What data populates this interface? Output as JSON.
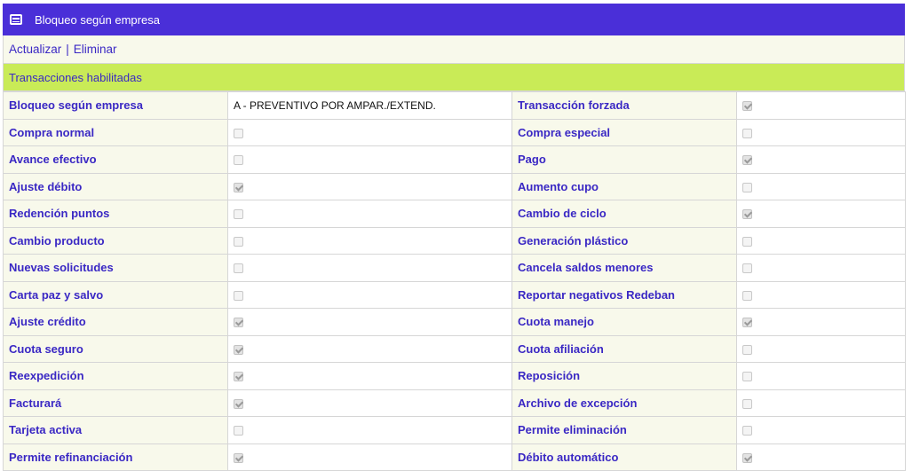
{
  "header": {
    "title": "Bloqueo según empresa",
    "icon": "window-icon"
  },
  "actions": {
    "update": "Actualizar",
    "separator": "|",
    "delete": "Eliminar"
  },
  "section": {
    "title": "Transacciones habilitadas"
  },
  "colors": {
    "header_bg": "#4a2fd8",
    "section_bg": "#c9eb57",
    "label_color": "#3a28c4",
    "label_bg": "#f8f9eb"
  },
  "rows": [
    {
      "left": "Bloqueo según empresa",
      "left_value": "A - PREVENTIVO POR AMPAR./EXTEND.",
      "right": "Transacción forzada",
      "right_checked": true
    },
    {
      "left": "Compra normal",
      "left_checked": false,
      "right": "Compra especial",
      "right_checked": false
    },
    {
      "left": "Avance efectivo",
      "left_checked": false,
      "right": "Pago",
      "right_checked": true
    },
    {
      "left": "Ajuste débito",
      "left_checked": true,
      "right": "Aumento cupo",
      "right_checked": false
    },
    {
      "left": "Redención puntos",
      "left_checked": false,
      "right": "Cambio de ciclo",
      "right_checked": true
    },
    {
      "left": "Cambio producto",
      "left_checked": false,
      "right": "Generación plástico",
      "right_checked": false
    },
    {
      "left": "Nuevas solicitudes",
      "left_checked": false,
      "right": "Cancela saldos menores",
      "right_checked": false
    },
    {
      "left": "Carta paz y salvo",
      "left_checked": false,
      "right": "Reportar negativos Redeban",
      "right_checked": false
    },
    {
      "left": "Ajuste crédito",
      "left_checked": true,
      "right": "Cuota manejo",
      "right_checked": true
    },
    {
      "left": "Cuota seguro",
      "left_checked": true,
      "right": "Cuota afiliación",
      "right_checked": false
    },
    {
      "left": "Reexpedición",
      "left_checked": true,
      "right": "Reposición",
      "right_checked": false
    },
    {
      "left": "Facturará",
      "left_checked": true,
      "right": "Archivo de excepción",
      "right_checked": false
    },
    {
      "left": "Tarjeta activa",
      "left_checked": false,
      "right": "Permite eliminación",
      "right_checked": false
    },
    {
      "left": "Permite refinanciación",
      "left_checked": true,
      "right": "Débito automático",
      "right_checked": true
    }
  ]
}
